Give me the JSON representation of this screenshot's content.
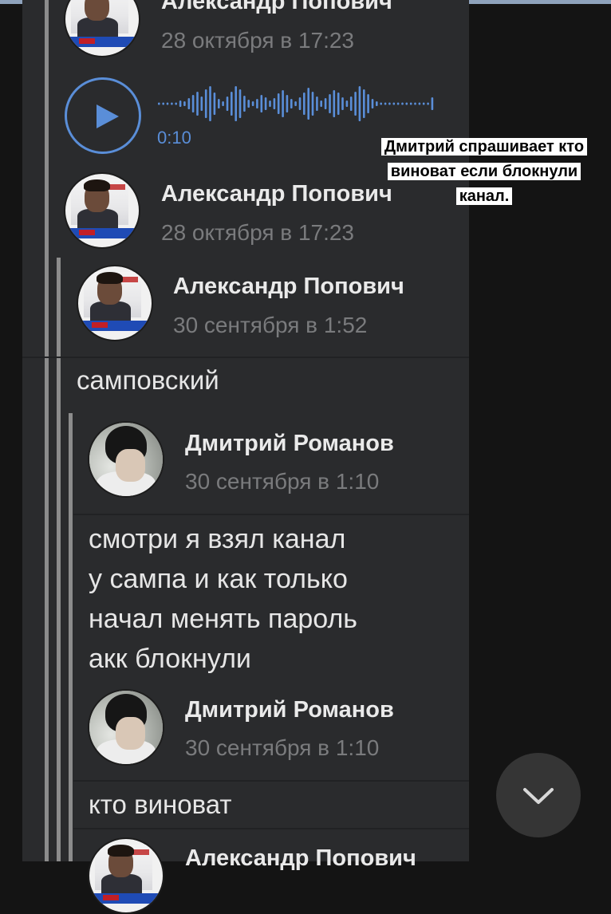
{
  "messages": [
    {
      "author": "Александр Попович",
      "date": "28 октября в 17:23"
    },
    {
      "voice_duration": "0:10"
    },
    {
      "author": "Александр Попович",
      "date": "28 октября в 17:23"
    },
    {
      "author": "Александр Попович",
      "date": "30 сентября в 1:52"
    },
    {
      "text": "самповский"
    },
    {
      "author": "Дмитрий Романов",
      "date": "30 сентября в 1:10"
    },
    {
      "lines": [
        "смотри я взял канал",
        "у сампа и как только",
        "начал менять пароль",
        "акк блокнули"
      ]
    },
    {
      "author": "Дмитрий Романов",
      "date": "30 сентября в 1:10"
    },
    {
      "text": "кто виноват"
    },
    {
      "author": "Александр Попович"
    }
  ],
  "caption": "Дмитрий спрашивает кто виноват если блокнули канал.",
  "icons": {
    "play": "play-icon",
    "scroll_down": "chevron-down-icon",
    "waveform": "waveform-icon"
  },
  "colors": {
    "accent": "#5a8ed8",
    "background": "#141414",
    "card": "#2a2b2d",
    "caption_bg": "#ffffff"
  }
}
